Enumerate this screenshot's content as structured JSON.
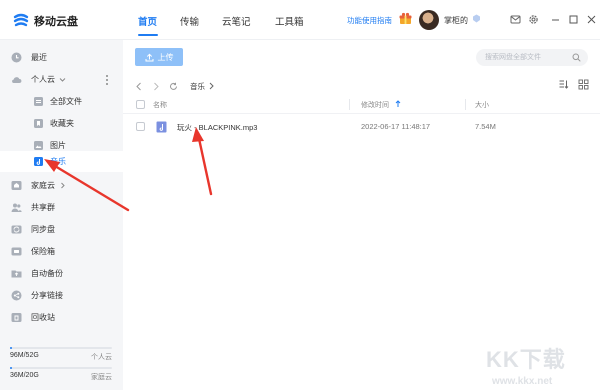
{
  "app": {
    "title": "移动云盘",
    "logo_icon": "cloud-logo-icon",
    "accent": "#1f7cf2"
  },
  "nav": {
    "tabs": [
      {
        "label": "首页",
        "active": true
      },
      {
        "label": "传输",
        "active": false
      },
      {
        "label": "云笔记",
        "active": false
      },
      {
        "label": "工具箱",
        "active": false
      }
    ],
    "guide_link": "功能使用指南",
    "username": "掌柜的"
  },
  "sidebar": {
    "items": [
      {
        "label": "最近",
        "icon": "clock-icon"
      },
      {
        "label": "个人云",
        "icon": "cloud-icon",
        "expand": "chevron-down-icon"
      },
      {
        "label": "全部文件",
        "icon": "folder-icon"
      },
      {
        "label": "收藏夹",
        "icon": "bookmark-icon"
      },
      {
        "label": "图片",
        "icon": "image-icon"
      },
      {
        "label": "音乐",
        "icon": "music-icon",
        "active": true
      },
      {
        "label": "家庭云",
        "icon": "home-icon",
        "expand": "chevron-right-icon"
      },
      {
        "label": "共享群",
        "icon": "group-icon"
      },
      {
        "label": "同步盘",
        "icon": "sync-icon"
      },
      {
        "label": "保险箱",
        "icon": "safe-icon"
      },
      {
        "label": "自动备份",
        "icon": "backup-folder-icon"
      },
      {
        "label": "分享链接",
        "icon": "share-icon"
      },
      {
        "label": "回收站",
        "icon": "trash-icon"
      }
    ],
    "storage": [
      {
        "used": "96M/52G",
        "name": "个人云",
        "fraction": 0.002
      },
      {
        "used": "36M/20G",
        "name": "家庭云",
        "fraction": 0.002
      }
    ]
  },
  "toolbar": {
    "upload_label": "上传",
    "search_placeholder": "搜索网盘全部文件"
  },
  "breadcrumb": {
    "current": "音乐"
  },
  "table": {
    "headers": {
      "name": "名称",
      "modified": "修改时间",
      "size": "大小"
    },
    "rows": [
      {
        "name": "玩火 - BLACKPINK.mp3",
        "modified": "2022-06-17 11:48:17",
        "size": "7.54M",
        "icon": "music-file-icon"
      }
    ]
  },
  "watermark": {
    "text": "KK下载",
    "url": "www.kkx.net"
  }
}
